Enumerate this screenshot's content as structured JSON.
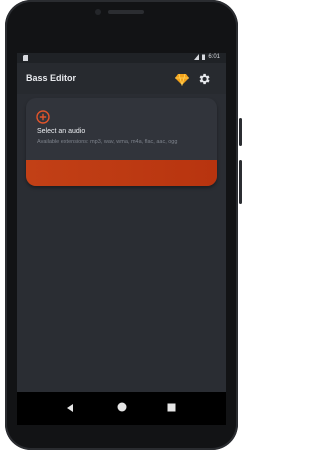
{
  "status_bar": {
    "time": "6:01"
  },
  "app_bar": {
    "title": "Bass Editor",
    "premium_icon": "diamond-icon",
    "settings_icon": "gear-icon"
  },
  "card": {
    "title": "Select an audio",
    "subtitle": "Available extensions: mp3, wav, wma, m4a, flac, aac, ogg",
    "add_icon": "add-circle-icon"
  },
  "colors": {
    "accent": "#c24016",
    "background": "#2a2d33",
    "card": "#31343b"
  }
}
